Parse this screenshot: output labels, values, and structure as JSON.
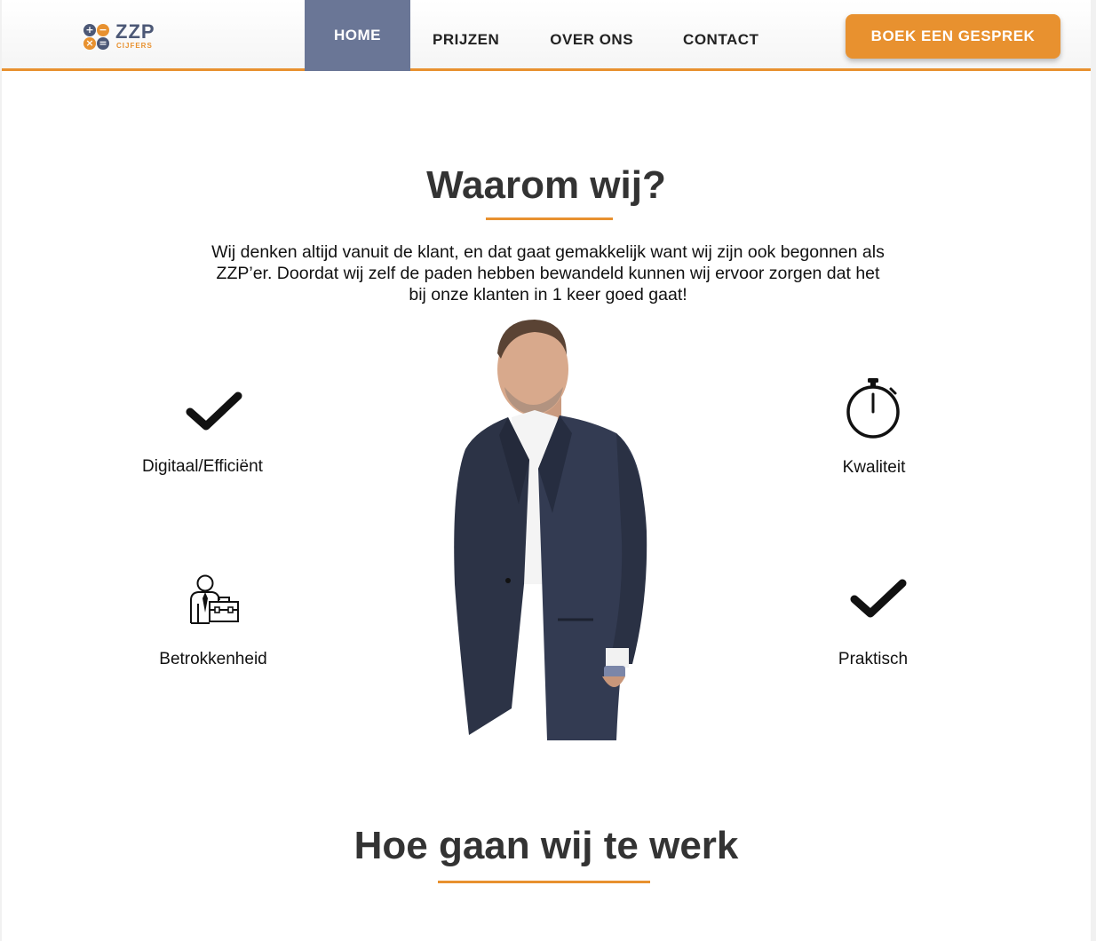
{
  "header": {
    "logo": {
      "word": "ZZP",
      "sub": "CIJFERS",
      "symbols": [
        "+",
        "−",
        "×",
        "="
      ]
    },
    "nav": [
      {
        "label": "HOME",
        "active": true
      },
      {
        "label": "PRIJZEN",
        "active": false
      },
      {
        "label": "OVER ONS",
        "active": false
      },
      {
        "label": "CONTACT",
        "active": false
      }
    ],
    "cta_label": "BOEK EEN GESPREK"
  },
  "section_why": {
    "title": "Waarom wij?",
    "intro": "Wij denken altijd vanuit de klant, en dat gaat gemakkelijk want wij zijn ook begonnen als ZZP’er. Doordat wij zelf de paden hebben bewandeld kunnen wij ervoor zorgen dat het bij onze klanten in 1 keer goed gaat!",
    "features": [
      {
        "label": "Digitaal/Efficiënt",
        "icon": "checkmark-icon"
      },
      {
        "label": "Kwaliteit",
        "icon": "stopwatch-icon"
      },
      {
        "label": "Betrokkenheid",
        "icon": "businessman-briefcase-icon"
      },
      {
        "label": "Praktisch",
        "icon": "checkmark-icon"
      }
    ]
  },
  "section_how": {
    "title": "Hoe gaan wij te werk"
  },
  "colors": {
    "accent": "#e8912f",
    "nav_active": "#6a7696",
    "brand_dark": "#4c5876"
  }
}
